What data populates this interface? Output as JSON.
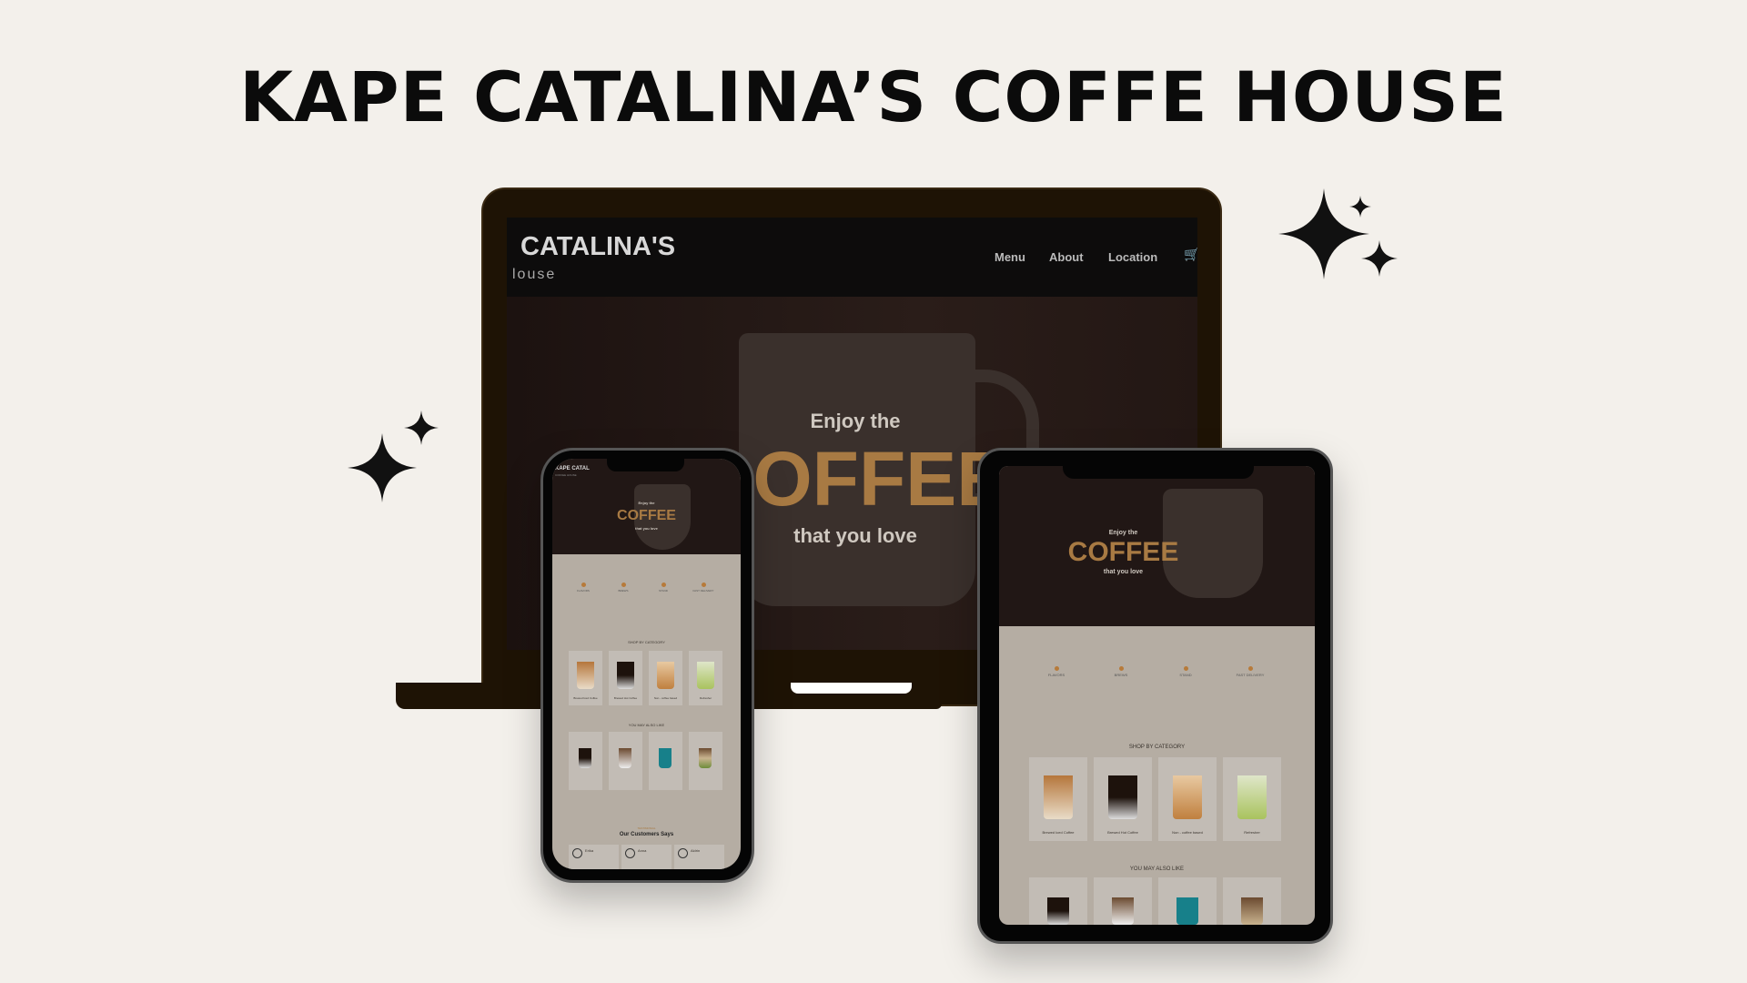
{
  "title": "KAPE CATALINA’S COFFE HOUSE",
  "laptop": {
    "logo": "CATALINA'S",
    "logo_sub": "louse",
    "nav": [
      "Menu",
      "About",
      "Location"
    ],
    "cart_icon": "cart-icon",
    "hero": {
      "line1": "Enjoy the",
      "line2": "COFFEE",
      "line3": "that you love"
    }
  },
  "phone": {
    "logo": "KAPE CATAL",
    "logo_sub": "COFFEE HOUSE",
    "hero": {
      "line1": "Enjoy the",
      "line2": "COFFEE",
      "line3": "that you love"
    },
    "features": [
      "FLAVORS",
      "BREWS",
      "STAND",
      "FAST DELIVERY"
    ],
    "shop_heading": "SHOP BY CATEGORY",
    "categories": [
      "Brewed Iced Coffee",
      "Brewed Hot Coffee",
      "Non - coffee based",
      "Refresher"
    ],
    "also_like_heading": "YOU MAY ALSO LIKE",
    "testimonial_label": "TESTIMONIAL",
    "testimonial_heading": "Our Customers Says",
    "reviewers": [
      "Erika",
      "Anna",
      "Aldrin"
    ]
  },
  "tablet": {
    "hero": {
      "line1": "Enjoy the",
      "line2": "COFFEE",
      "line3": "that you love"
    },
    "features": [
      "FLAVORS",
      "BREWS",
      "STAND",
      "FAST DELIVERY"
    ],
    "shop_heading": "SHOP BY CATEGORY",
    "categories": [
      "Brewed Iced Coffee",
      "Brewed Hot Coffee",
      "Non - coffee based",
      "Refresher"
    ],
    "also_like_heading": "YOU MAY ALSO LIKE"
  },
  "colors": {
    "background": "#f3f0eb",
    "laptop": "#1e1305",
    "accent": "#a87a43"
  }
}
